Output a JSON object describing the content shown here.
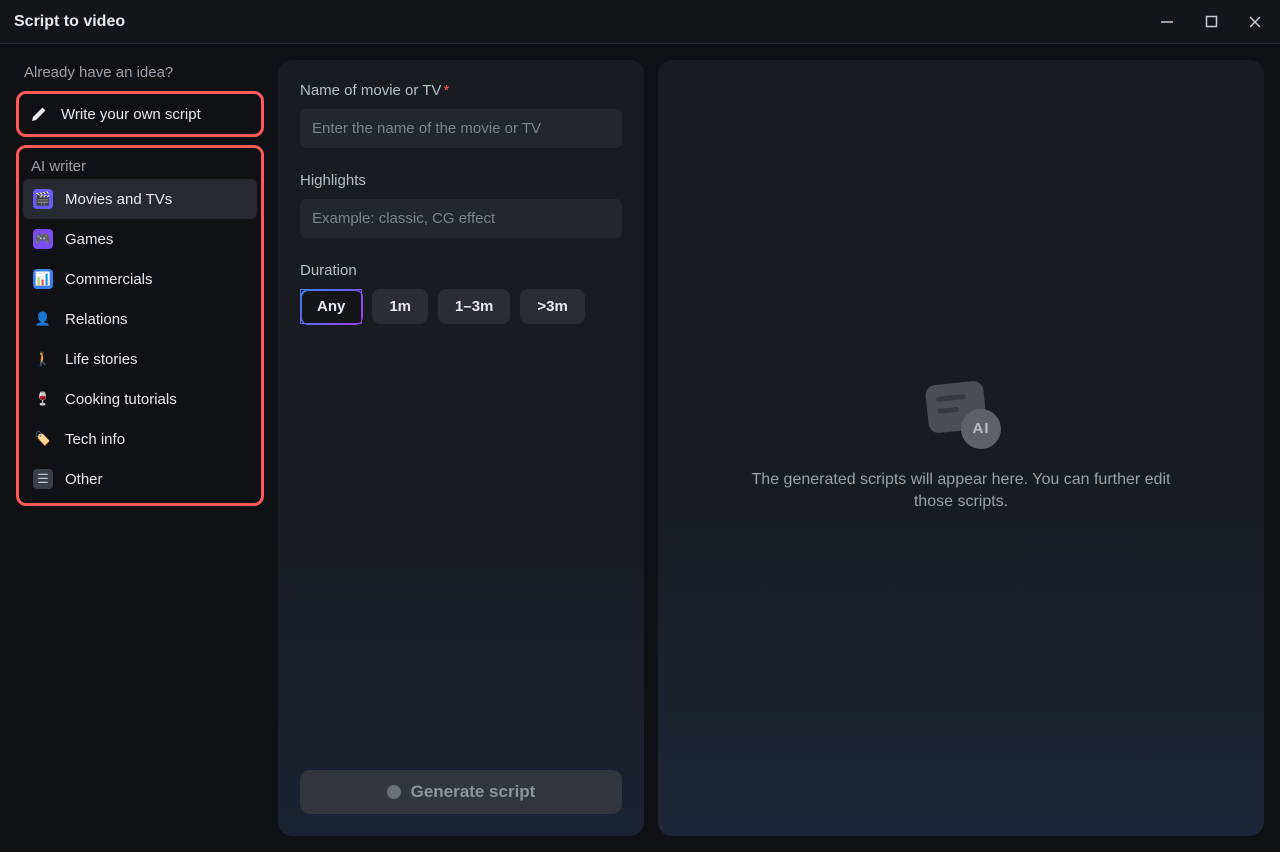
{
  "titlebar": {
    "title": "Script to video"
  },
  "sidebar": {
    "idea_label": "Already have an idea?",
    "write_own_label": "Write your own script",
    "ai_writer_label": "AI writer",
    "categories": [
      {
        "label": "Movies and TVs",
        "active": true
      },
      {
        "label": "Games"
      },
      {
        "label": "Commercials"
      },
      {
        "label": "Relations"
      },
      {
        "label": "Life stories"
      },
      {
        "label": "Cooking tutorials"
      },
      {
        "label": "Tech info"
      },
      {
        "label": "Other"
      }
    ]
  },
  "form": {
    "name_label": "Name of movie or TV",
    "name_placeholder": "Enter the name of the movie or TV",
    "highlights_label": "Highlights",
    "highlights_placeholder": "Example: classic, CG effect",
    "duration_label": "Duration",
    "durations": [
      {
        "label": "Any",
        "selected": true
      },
      {
        "label": "1m"
      },
      {
        "label": "1–3m"
      },
      {
        "label": ">3m"
      }
    ],
    "generate_label": "Generate script"
  },
  "results": {
    "badge": "AI",
    "empty_text": "The generated scripts will appear here. You can further edit those scripts."
  }
}
